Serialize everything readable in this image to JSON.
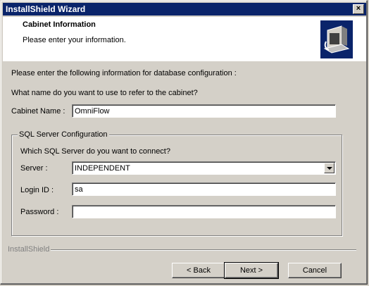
{
  "window": {
    "title": "InstallShield Wizard",
    "close_label": "×"
  },
  "header": {
    "title": "Cabinet Information",
    "subtitle": "Please enter your information."
  },
  "main": {
    "intro": "Please enter the following information for database configuration :",
    "question": "What name do you want to use to refer to the cabinet?",
    "cabinet_name_label": "Cabinet Name :",
    "cabinet_name_value": "OmniFlow"
  },
  "sql_group": {
    "title": "SQL Server Configuration",
    "question": "Which SQL Server do you want to connect?",
    "server_label": "Server :",
    "server_value": "INDEPENDENT",
    "login_label": "Login ID :",
    "login_value": "sa",
    "password_label": "Password :",
    "password_value": ""
  },
  "footer": {
    "brand": "InstallShield",
    "back_label": "< Back",
    "next_label": "Next >",
    "cancel_label": "Cancel"
  },
  "icons": {
    "logo": "installshield-computer-icon",
    "close": "close-icon",
    "dropdown": "chevron-down-icon"
  }
}
